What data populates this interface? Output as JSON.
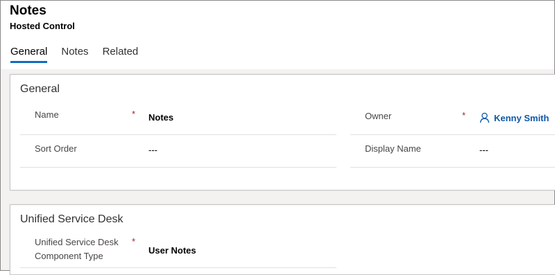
{
  "header": {
    "title": "Notes",
    "subtitle": "Hosted Control"
  },
  "tabs": [
    {
      "label": "General",
      "active": true
    },
    {
      "label": "Notes",
      "active": false
    },
    {
      "label": "Related",
      "active": false
    }
  ],
  "general": {
    "section_title": "General",
    "name_label": "Name",
    "name_value": "Notes",
    "sort_order_label": "Sort Order",
    "sort_order_value": "---",
    "owner_label": "Owner",
    "owner_value": "Kenny Smith",
    "display_name_label": "Display Name",
    "display_name_value": "---",
    "required_marker": "*"
  },
  "usd": {
    "section_title": "Unified Service Desk",
    "component_type_label_line1": "Unified Service Desk",
    "component_type_label_line2": "Component Type",
    "component_type_value": "User Notes",
    "required_marker": "*"
  },
  "icons": {
    "owner": "person-icon"
  },
  "colors": {
    "accent": "#0f6cbd",
    "link": "#0f58a8",
    "required": "#a4262c"
  }
}
